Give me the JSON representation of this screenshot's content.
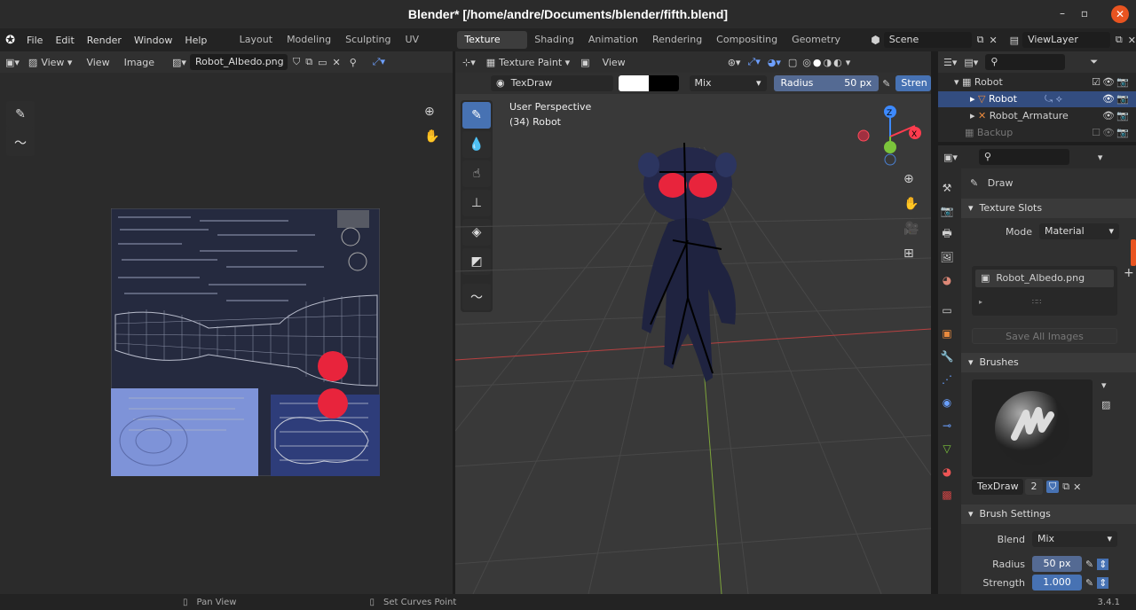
{
  "window": {
    "title": "Blender* [/home/andre/Documents/blender/fifth.blend]",
    "minimize": "–",
    "maximize": "▫",
    "close": "✕"
  },
  "menu": {
    "items": [
      "File",
      "Edit",
      "Render",
      "Window",
      "Help"
    ]
  },
  "workspaces": [
    "Layout",
    "Modeling",
    "Sculpting",
    "UV Editing",
    "Texture Paint",
    "Shading",
    "Animation",
    "Rendering",
    "Compositing",
    "Geometry Node"
  ],
  "scene": {
    "name": "Scene",
    "view_layer": "ViewLayer"
  },
  "image_editor": {
    "view1": "View",
    "view2": "View",
    "image": "Image",
    "image_name": "Robot_Albedo.png"
  },
  "viewport": {
    "mode": "Texture Paint",
    "view": "View",
    "brush_name": "TexDraw",
    "blend": "Mix",
    "radius_label": "Radius",
    "radius_value": "50 px",
    "strength_label": "Stren",
    "perspective": "User Perspective",
    "object": "(34) Robot"
  },
  "outliner": {
    "items": [
      {
        "label": "Robot"
      },
      {
        "label": "Robot"
      },
      {
        "label": "Robot_Armature"
      },
      {
        "label": "Backup"
      }
    ]
  },
  "properties": {
    "tool": "Draw",
    "texture_slots": "Texture Slots",
    "mode_label": "Mode",
    "mode_value": "Material",
    "slot_item": "Robot_Albedo.png",
    "save_all": "Save All Images",
    "brushes": "Brushes",
    "brush_name": "TexDraw",
    "brush_users": "2",
    "brush_settings": "Brush Settings",
    "blend_label": "Blend",
    "blend_value": "Mix",
    "radius_label": "Radius",
    "radius_value": "50 px",
    "strength_label": "Strength",
    "strength_value": "1.000"
  },
  "status": {
    "pan": "Pan View",
    "curves": "Set Curves Point",
    "version": "3.4.1"
  },
  "colors": {
    "accent": "#4772b3",
    "red": "#e8243c",
    "blue_uv": "#7e93d8",
    "uv_bg": "#252a3f"
  }
}
